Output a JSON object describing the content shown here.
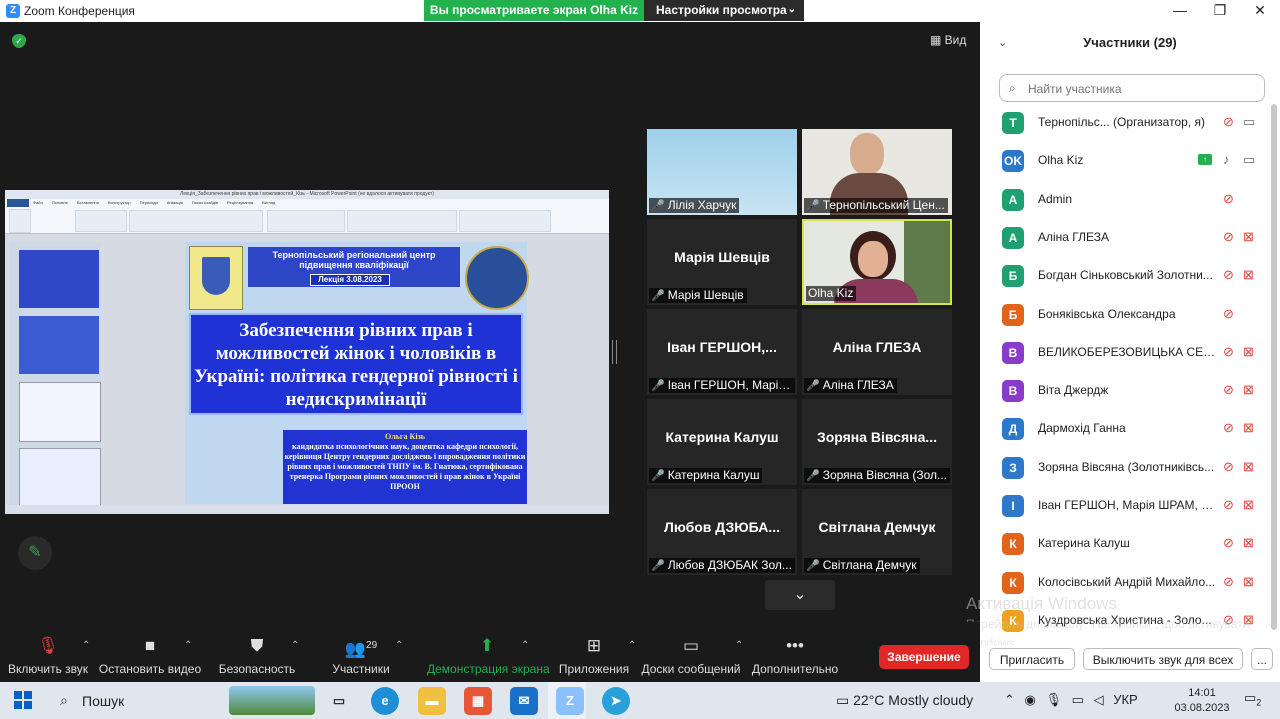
{
  "window": {
    "title": "Zoom Конференция",
    "share_banner": "Вы просматриваете экран Olha Kiz",
    "view_settings": "Настройки просмотра",
    "view_button": "Вид"
  },
  "shared_slide": {
    "window_title": "Лекція_Забезпечення рівних прав і можливостей_Кізь - Microsoft PowerPoint (не вдалося активувати продукт)",
    "ribbon_tabs": [
      "Файл",
      "Основне",
      "Вставлення",
      "Конструктор",
      "Переходи",
      "Анімація",
      "Показ слайдів",
      "Рецензування",
      "Вигляд"
    ],
    "header": "Тернопільський регіональний центр підвищення кваліфікації",
    "lecture": "Лекція 3.08.2023",
    "title": "Забезпечення рівних прав і можливостей жінок і чоловіків в Україні: політика гендерної рівності  і недискримінації",
    "author_name": "Ольга Кізь",
    "author_desc": "кандидатка психологічних наук,  доцентка кафедри психології, керівниця Центру гендерних досліджень і впровадження політики рівних прав  і можливостей ТНПУ ім. В. Гнатюка, сертифікована тренерка Програми рівних можливостей і прав жінок в Україні  ПРООН"
  },
  "video_tiles": [
    {
      "name": "Лілія Харчук",
      "big": "",
      "kind": "sky"
    },
    {
      "name": "Тернопільський Цен...",
      "big": "",
      "kind": "man"
    },
    {
      "name": "Марія Шевців",
      "big": "Марія Шевців",
      "kind": "plain"
    },
    {
      "name": "Olha Kiz",
      "big": "",
      "kind": "woman"
    },
    {
      "name": "Іван ГЕРШОН, Марія...",
      "big": "Іван  ГЕРШОН,...",
      "kind": "plain"
    },
    {
      "name": "Аліна ГЛЕЗА",
      "big": "Аліна ГЛЕЗА",
      "kind": "plain"
    },
    {
      "name": "Катерина Калуш",
      "big": "Катерина Калуш",
      "kind": "plain"
    },
    {
      "name": "Зоряна Вівсяна (Зол...",
      "big": "Зоряна  Вівсяна...",
      "kind": "plain"
    },
    {
      "name": "Любов ДЗЮБАК Зол...",
      "big": "Любов  ДЗЮБА...",
      "kind": "plain"
    },
    {
      "name": "Світлана Демчук",
      "big": "Світлана Демчук",
      "kind": "plain"
    }
  ],
  "participants": {
    "title": "Участники (29)",
    "search_placeholder": "Найти участника",
    "items": [
      {
        "initial": "T",
        "color": "#20a070",
        "name": "Тернопільс...  (Организатор, я)",
        "mic": "off",
        "cam": "on"
      },
      {
        "initial": "OK",
        "color": "#2d78c8",
        "name": "Olha Kiz",
        "mic": "on",
        "cam": "on",
        "sharing": true
      },
      {
        "initial": "A",
        "color": "#20a070",
        "name": "Admin",
        "mic": "off",
        "cam": ""
      },
      {
        "initial": "A",
        "color": "#20a070",
        "name": "Аліна ГЛЕЗА",
        "mic": "off",
        "cam": "off"
      },
      {
        "initial": "Б",
        "color": "#20a070",
        "name": "Богдан Сіньковський Золотни...",
        "mic": "off",
        "cam": "off"
      },
      {
        "initial": "Б",
        "color": "#e0641c",
        "name": "Боняківська Олександра",
        "mic": "off",
        "cam": ""
      },
      {
        "initial": "В",
        "color": "#8a3cc8",
        "name": "ВЕЛИКОБЕРЕЗОВИЦЬКА СЕЛИЩ...",
        "mic": "off",
        "cam": "off"
      },
      {
        "initial": "В",
        "color": "#8a3cc8",
        "name": "Віта Джердж",
        "mic": "off",
        "cam": "off"
      },
      {
        "initial": "Д",
        "color": "#2d78c8",
        "name": "Дармохід Ганна",
        "mic": "off",
        "cam": "off"
      },
      {
        "initial": "З",
        "color": "#2d78c8",
        "name": "Зоряна Вівсяна (Золотниківсь...",
        "mic": "off",
        "cam": "off"
      },
      {
        "initial": "І",
        "color": "#2d78c8",
        "name": "Іван ГЕРШОН, Марія ШРАМ, З...",
        "mic": "off",
        "cam": "off"
      },
      {
        "initial": "К",
        "color": "#e0641c",
        "name": "Катерина Калуш",
        "mic": "off",
        "cam": "off"
      },
      {
        "initial": "К",
        "color": "#e0641c",
        "name": "Колосівський Андрій Михайло...",
        "mic": "off",
        "cam": "off"
      },
      {
        "initial": "К",
        "color": "#f0a020",
        "name": "Куздровська Христина - Золо...",
        "mic": "off",
        "cam": "off"
      }
    ],
    "invite_label": "Пригласить",
    "mute_all_label": "Выключить звук для всех",
    "more_label": "..."
  },
  "watermark": {
    "line1": "Активація Windows",
    "line2": "Перейдіть до розділу \"Настройки\", щоб активувати Windows."
  },
  "toolbar": {
    "items": [
      {
        "label": "Включить звук",
        "icon": "mic-off-icon"
      },
      {
        "label": "Остановить видео",
        "icon": "video-icon"
      },
      {
        "label": "Безопасность",
        "icon": "shield-icon"
      },
      {
        "label": "Участники",
        "icon": "participants-icon",
        "count": "29"
      },
      {
        "label": "Демонстрация экрана",
        "icon": "share-screen-icon"
      },
      {
        "label": "Приложения",
        "icon": "apps-icon"
      },
      {
        "label": "Доски сообщений",
        "icon": "whiteboard-icon"
      },
      {
        "label": "Дополнительно",
        "icon": "more-icon"
      }
    ],
    "end_label": "Завершение"
  },
  "taskbar": {
    "search_label": "Пошук",
    "weather": "22°C  Mostly cloudy",
    "lang": "УКР",
    "time": "14:01",
    "date": "03.08.2023",
    "notifications": "2"
  }
}
